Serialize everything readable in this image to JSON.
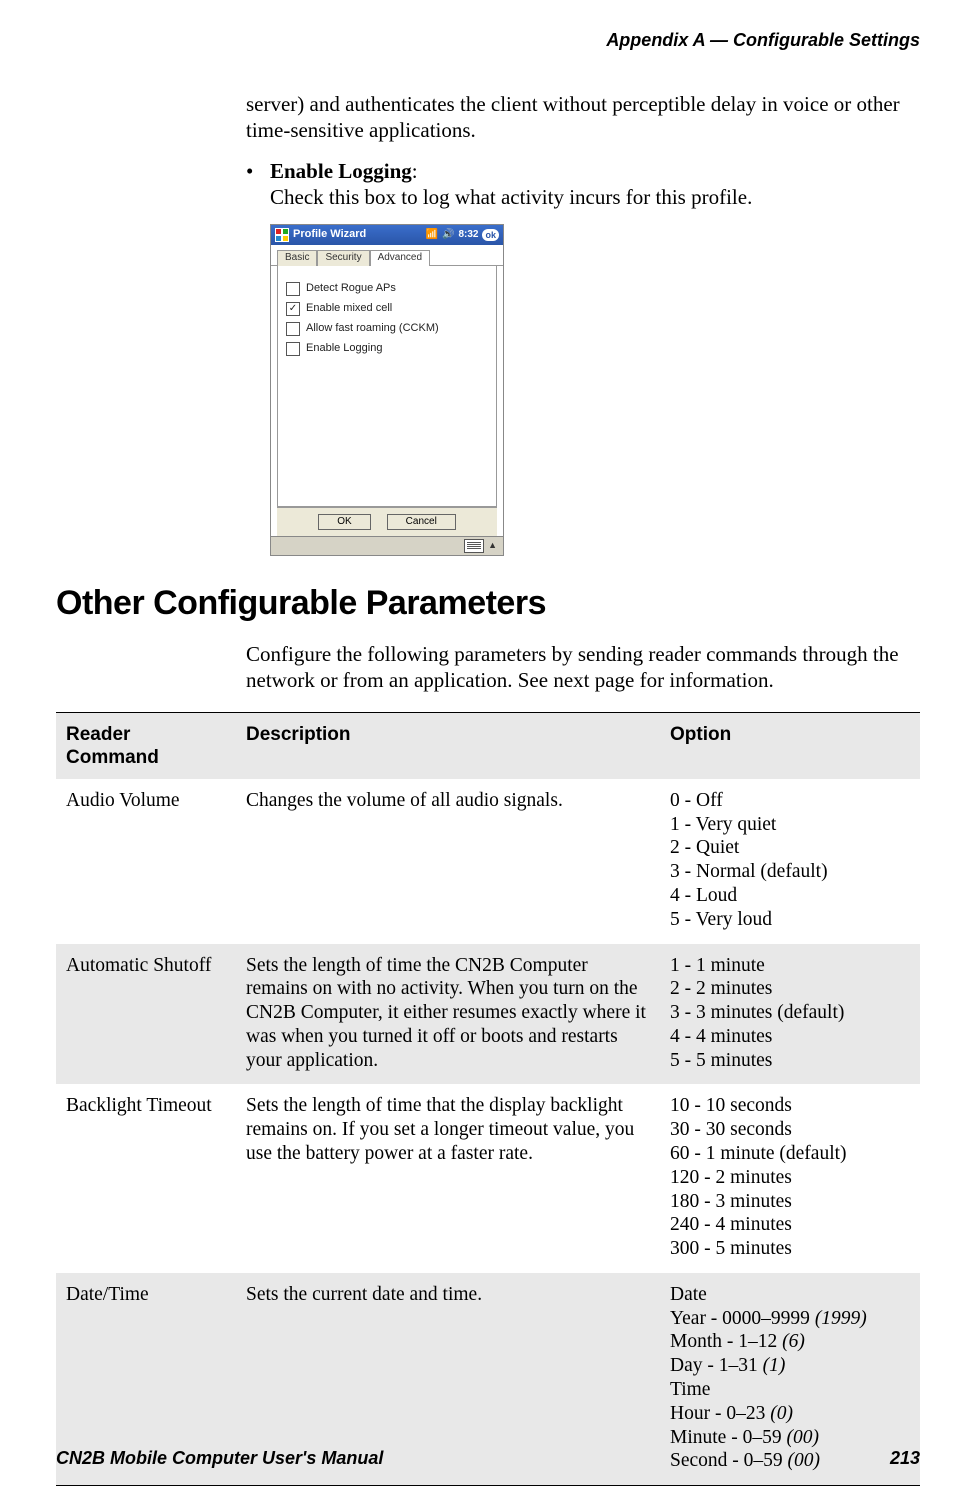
{
  "running_head": "Appendix A —  Configurable Settings",
  "intro_para": "server) and authenticates the client without perceptible delay in voice or other time-sensitive applications.",
  "bullet_label": "Enable Logging",
  "bullet_colon": ":",
  "bullet_text": "Check this box to log what activity incurs for this profile.",
  "screenshot": {
    "title": "Profile Wizard",
    "time": "8:32",
    "ok": "ok",
    "tabs": {
      "basic": "Basic",
      "security": "Security",
      "advanced": "Advanced"
    },
    "checks": {
      "rogue": {
        "label": "Detect Rogue APs",
        "checked": ""
      },
      "mixed": {
        "label": "Enable mixed cell",
        "checked": "✓"
      },
      "cckm": {
        "label": "Allow fast roaming (CCKM)",
        "checked": ""
      },
      "logging": {
        "label": "Enable Logging",
        "checked": ""
      }
    },
    "buttons": {
      "ok": "OK",
      "cancel": "Cancel"
    }
  },
  "section_heading": "Other Configurable Parameters",
  "section_para": "Configure the following parameters by sending reader commands through the network or from an application. See next page for information.",
  "table": {
    "headers": {
      "cmd": "Reader Command",
      "desc": "Description",
      "opt": "Option"
    },
    "rows": {
      "audio": {
        "cmd": "Audio Volume",
        "desc": "Changes the volume of all audio signals.",
        "opt": "0 - Off\n1 - Very quiet\n2 - Quiet\n3 - Normal (default)\n4 - Loud\n5 - Very loud"
      },
      "shutoff": {
        "cmd": "Automatic Shutoff",
        "desc": "Sets the length of time the CN2B Computer remains on with no activity. When you turn on the CN2B Computer, it either resumes exactly where it was when you turned it off or boots and restarts your application.",
        "opt": "1 - 1 minute\n2 - 2 minutes\n3 - 3 minutes (default)\n4 - 4 minutes\n5 - 5 minutes"
      },
      "backlight": {
        "cmd": "Backlight Timeout",
        "desc": "Sets the length of time that the display backlight remains on. If you set a longer timeout value, you use the battery power at a faster rate.",
        "opt": "10 - 10 seconds\n30 - 30 seconds\n60 - 1 minute (default)\n120 - 2 minutes\n180 - 3 minutes\n240 - 4 minutes\n300 - 5 minutes"
      },
      "datetime": {
        "cmd": "Date/Time",
        "desc": "Sets the current date and time.",
        "opt_pre_1": "Date\nYear - 0000–9999 ",
        "opt_it_1": "(1999)",
        "opt_pre_2": "\nMonth - 1–12 ",
        "opt_it_2": "(6)",
        "opt_pre_3": "\nDay - 1–31 ",
        "opt_it_3": "(1)",
        "opt_pre_4": "\nTime\nHour - 0–23 ",
        "opt_it_4": "(0)",
        "opt_pre_5": "\nMinute - 0–59 ",
        "opt_it_5": "(00)",
        "opt_pre_6": "\nSecond - 0–59 ",
        "opt_it_6": "(00)"
      }
    }
  },
  "footer": {
    "left": "CN2B Mobile Computer User's Manual",
    "right": "213"
  }
}
